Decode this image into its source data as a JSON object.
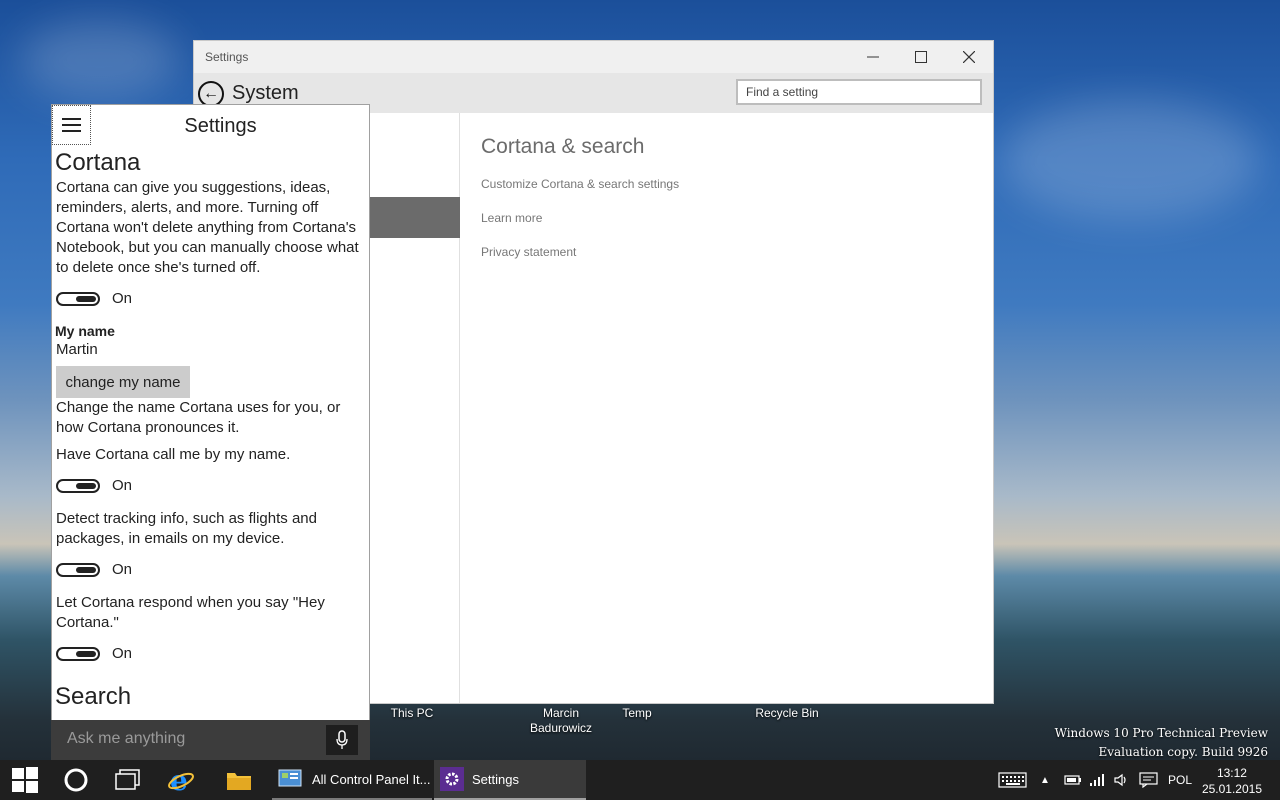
{
  "desktop": {
    "icons": [
      "This PC",
      "Marcin Badurowicz",
      "Temp",
      "Recycle Bin"
    ],
    "watermark_line1": "Windows 10 Pro Technical Preview",
    "watermark_line2": "Evaluation copy. Build 9926"
  },
  "settings_window": {
    "title": "Settings",
    "header": "System",
    "find_placeholder": "Find a setting",
    "content": {
      "title": "Cortana & search",
      "links": [
        "Customize Cortana & search settings",
        "Learn more",
        "Privacy statement"
      ]
    }
  },
  "cortana": {
    "title": "Settings",
    "section_cortana": "Cortana",
    "cortana_desc": "Cortana can give you suggestions, ideas, reminders, alerts, and more. Turning off Cortana won't delete anything from Cortana's Notebook, but you can manually choose what to delete once she's turned off.",
    "toggle_state": "On",
    "my_name_label": "My name",
    "my_name_value": "Martin",
    "change_name_button": "change my name",
    "change_name_desc": "Change the name Cortana uses for you, or how Cortana pronounces it.",
    "call_by_name": "Have Cortana call me by my name.",
    "tracking_desc": "Detect tracking info, such as flights and packages, in emails on my device.",
    "hey_cortana": "Let Cortana respond when you say \"Hey Cortana.\"",
    "section_search": "Search",
    "ask_placeholder": "Ask me anything"
  },
  "taskbar": {
    "apps": [
      "All Control Panel It...",
      "Settings"
    ],
    "language": "POL",
    "time": "13:12",
    "date": "25.01.2015"
  },
  "colors": {
    "settings_accent": "#5b2d91",
    "ie_blue": "#1e90ff",
    "explorer_yellow": "#f3c13a"
  }
}
